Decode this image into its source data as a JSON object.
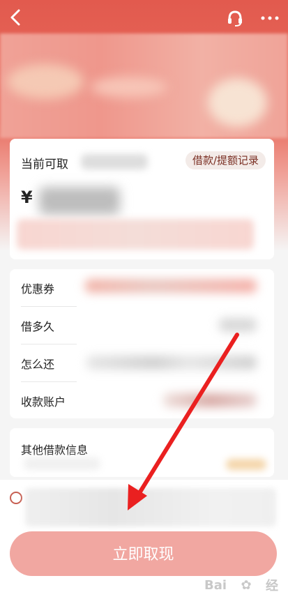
{
  "header": {
    "back_icon": "back-icon",
    "support_icon": "headset-icon",
    "more_icon": "more-icon"
  },
  "summary": {
    "title": "当前可取",
    "history_button": "借款/提额记录",
    "currency": "¥"
  },
  "details": [
    {
      "label": "优惠券"
    },
    {
      "label": "借多久"
    },
    {
      "label": "怎么还"
    },
    {
      "label": "收款账户"
    }
  ],
  "other": {
    "title": "其他借款信息"
  },
  "cta": {
    "button_label": "立即取现"
  },
  "colors": {
    "brand_red": "#e25a4e",
    "button_pink": "#f1a7a1",
    "annotation_red": "#ea2020"
  }
}
